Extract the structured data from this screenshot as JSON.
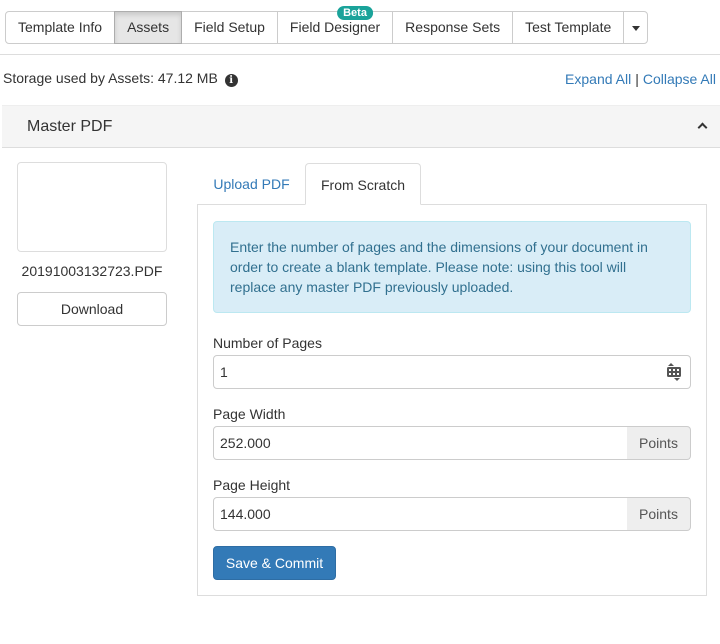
{
  "tabs": [
    {
      "label": "Template Info",
      "active": false
    },
    {
      "label": "Assets",
      "active": true
    },
    {
      "label": "Field Setup",
      "active": false
    },
    {
      "label": "Field Designer",
      "active": false,
      "badge": "Beta"
    },
    {
      "label": "Response Sets",
      "active": false
    },
    {
      "label": "Test Template",
      "active": false
    }
  ],
  "storage": {
    "label": "Storage used by Assets: 47.12 MB",
    "icon": "info-circle-icon"
  },
  "links": {
    "expand_all": "Expand All",
    "separator": "|",
    "collapse_all": "Collapse All"
  },
  "panel": {
    "title": "Master PDF"
  },
  "preview": {
    "filename": "20191003132723.PDF",
    "download_label": "Download"
  },
  "subtabs": {
    "upload": "Upload PDF",
    "scratch": "From Scratch",
    "active": "From Scratch"
  },
  "alert": {
    "text": "Enter the number of pages and the dimensions of your document in order to create a blank template. Please note: using this tool will replace any master PDF previously uploaded."
  },
  "form": {
    "pages": {
      "label": "Number of Pages",
      "value": "1"
    },
    "width": {
      "label": "Page Width",
      "value": "252.000",
      "unit": "Points"
    },
    "height": {
      "label": "Page Height",
      "value": "144.000",
      "unit": "Points"
    }
  },
  "save_label": "Save & Commit",
  "colors": {
    "link": "#337ab7",
    "primary": "#337ab7",
    "alert_bg": "#d9edf7",
    "alert_text": "#31708f",
    "badge": "#1aa39a"
  }
}
